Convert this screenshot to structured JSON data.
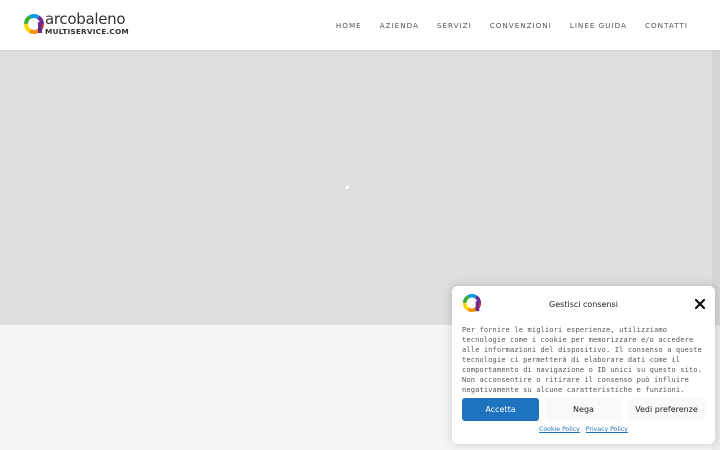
{
  "brand": {
    "name": "arcobaleno",
    "subtitle": "MULTISERVICE.COM",
    "colors": [
      "#e5332a",
      "#f39200",
      "#ffd500",
      "#3aaa35",
      "#009fe3",
      "#6c2b8f"
    ]
  },
  "nav": {
    "items": [
      "HOME",
      "AZIENDA",
      "SERVIZI",
      "CONVENZIONI",
      "LINEE GUIDA",
      "CONTATTI"
    ]
  },
  "cookie": {
    "title": "Gestisci consensi",
    "close_icon": "close-icon",
    "text": "Per fornire le migliori esperienze, utilizziamo tecnologie come i cookie per memorizzare e/o accedere alle informazioni del dispositivo. Il consenso a queste tecnologie ci permetterà di elaborare dati come il comportamento di navigazione o ID unici su questo sito. Non acconsentire o ritirare il consenso può influire negativamente su alcune caratteristiche e funzioni.",
    "accept_label": "Accetta",
    "deny_label": "Nega",
    "prefs_label": "Vedi preferenze",
    "cookie_policy_label": "Cookie Policy",
    "privacy_policy_label": "Privacy Policy",
    "accent": "#1e73be"
  }
}
